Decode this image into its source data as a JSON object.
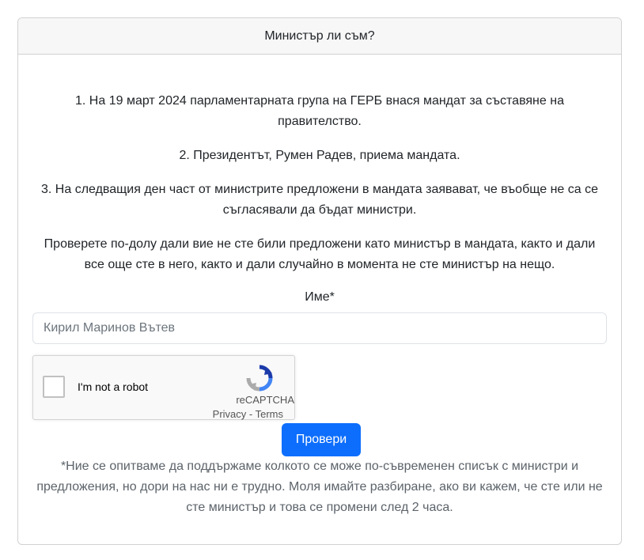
{
  "card": {
    "title": "Министър ли съм?"
  },
  "intro": {
    "p1": "1. На 19 март 2024 парламентарната група на ГЕРБ внася мандат за съставяне на правителство.",
    "p2": "2. Президентът, Румен Радев, приема мандата.",
    "p3": "3. На следващия ден част от министрите предложени в мандата заявават, че въобще не са се съгласявали да бъдат министри.",
    "p4": "Проверете по-долу дали вие не сте били предложени като министър в мандата, както и дали все още сте в него, както и дали случайно в момента не сте министър на нещо."
  },
  "form": {
    "name_label": "Име*",
    "name_value": "Кирил Маринов Вътев",
    "submit_label": "Провери"
  },
  "captcha": {
    "label": "I'm not a robot",
    "brand": "reCAPTCHA",
    "privacy": "Privacy",
    "separator": " - ",
    "terms": "Terms",
    "icon": "recaptcha-logo"
  },
  "footer_note": "*Ние се опитваме да поддържаме колкото се може по-съвременен списък с министри и предложения, но дори на нас ни е трудно. Моля имайте разбиране, ако ви кажем, че сте или не сте министър и това се промени след 2 часа.",
  "colors": {
    "primary": "#0d6efd",
    "header_bg": "#f7f7f7",
    "muted": "#5c636a"
  }
}
